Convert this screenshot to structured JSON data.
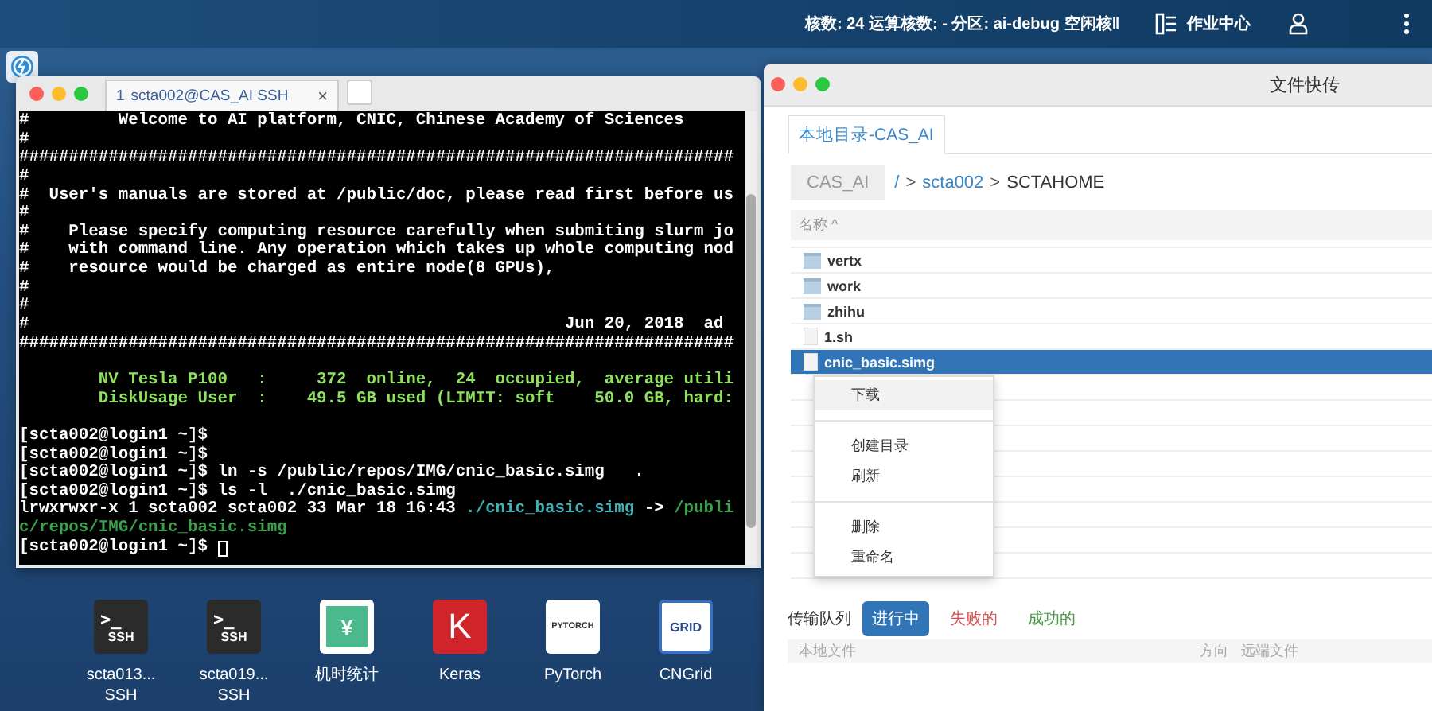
{
  "top_bar": {
    "status": "核数: 24 运算核数: - 分区: ai-debug 空闲核‖",
    "jobs_link": "作业中心"
  },
  "terminal": {
    "tab": {
      "number": "1",
      "title": "scta002@CAS_AI SSH",
      "close": "×"
    },
    "lines": [
      {
        "kind": "plain",
        "segments": [
          {
            "kind": "white",
            "text": "#         Welcome to AI platform, CNIC, Chinese Academy of Sciences"
          }
        ]
      },
      {
        "kind": "plain",
        "segments": [
          {
            "kind": "white",
            "text": "#"
          }
        ]
      },
      {
        "kind": "plain",
        "segments": [
          {
            "kind": "white",
            "text": "########################################################################"
          }
        ]
      },
      {
        "kind": "plain",
        "segments": [
          {
            "kind": "white",
            "text": "#"
          }
        ]
      },
      {
        "kind": "plain",
        "segments": [
          {
            "kind": "white",
            "text": "#  User's manuals are stored at /public/doc, please read first before us"
          }
        ]
      },
      {
        "kind": "plain",
        "segments": [
          {
            "kind": "white",
            "text": "#"
          }
        ]
      },
      {
        "kind": "plain",
        "segments": [
          {
            "kind": "white",
            "text": "#    Please specify computing resource carefully when submiting slurm jo"
          }
        ]
      },
      {
        "kind": "plain",
        "segments": [
          {
            "kind": "white",
            "text": "#    with command line. Any operation which takes up whole computing nod"
          }
        ]
      },
      {
        "kind": "plain",
        "segments": [
          {
            "kind": "white",
            "text": "#    resource would be charged as entire node(8 GPUs),"
          }
        ]
      },
      {
        "kind": "plain",
        "segments": [
          {
            "kind": "white",
            "text": "#"
          }
        ]
      },
      {
        "kind": "plain",
        "segments": [
          {
            "kind": "white",
            "text": "#"
          }
        ]
      },
      {
        "kind": "plain",
        "segments": [
          {
            "kind": "white",
            "text": "#                                                      Jun 20, 2018  ad"
          }
        ]
      },
      {
        "kind": "plain",
        "segments": [
          {
            "kind": "white",
            "text": "########################################################################"
          }
        ]
      },
      {
        "kind": "blank"
      },
      {
        "kind": "plain",
        "segments": [
          {
            "kind": "green",
            "text": "        NV Tesla P100   :     372  online,  24  occupied,  average utili"
          }
        ]
      },
      {
        "kind": "plain",
        "segments": [
          {
            "kind": "green",
            "text": "        DiskUsage User  :    49.5 GB used (LIMIT: soft    50.0 GB, hard:"
          }
        ]
      },
      {
        "kind": "blank"
      },
      {
        "kind": "plain",
        "segments": [
          {
            "kind": "white",
            "text": "[scta002@login1 ~]$"
          }
        ]
      },
      {
        "kind": "plain",
        "segments": [
          {
            "kind": "white",
            "text": "[scta002@login1 ~]$"
          }
        ]
      },
      {
        "kind": "plain",
        "segments": [
          {
            "kind": "white",
            "text": "[scta002@login1 ~]$ ln -s /public/repos/IMG/cnic_basic.simg   ."
          }
        ]
      },
      {
        "kind": "plain",
        "segments": [
          {
            "kind": "white",
            "text": "[scta002@login1 ~]$ ls -l  ./cnic_basic.simg"
          }
        ]
      },
      {
        "kind": "plain",
        "segments": [
          {
            "kind": "white",
            "text": "lrwxrwxr-x 1 scta002 scta002 33 Mar 18 16:43 "
          },
          {
            "kind": "link",
            "text": "./cnic_basic.simg"
          },
          {
            "kind": "white",
            "text": " -> "
          },
          {
            "kind": "target",
            "text": "/publi"
          }
        ]
      },
      {
        "kind": "plain",
        "segments": [
          {
            "kind": "target",
            "text": "c/repos/IMG/cnic_basic.simg"
          }
        ]
      },
      {
        "kind": "prompt",
        "segments": [
          {
            "kind": "white",
            "text": "[scta002@login1 ~]$ "
          }
        ]
      }
    ]
  },
  "desktop_icons": [
    {
      "kind": "ssh",
      "glyph": ">_",
      "badge": "SSH",
      "label": "scta013...",
      "sublabel": "SSH"
    },
    {
      "kind": "ssh",
      "glyph": ">_",
      "badge": "SSH",
      "label": "scta019...",
      "sublabel": "SSH"
    },
    {
      "kind": "yen",
      "glyph": "¥",
      "label": "机时统计"
    },
    {
      "kind": "keras",
      "glyph": "K",
      "label": "Keras"
    },
    {
      "kind": "pytorch",
      "glyph": "PYTORCH",
      "label": "PyTorch"
    },
    {
      "kind": "cngrid",
      "glyph": "GRID",
      "label": "CNGrid"
    }
  ],
  "file_window": {
    "title": "文件快传",
    "tab": "本地目录-CAS_AI",
    "breadcrumb": {
      "root": "CAS_AI",
      "parts": [
        {
          "kind": "link",
          "text": "/"
        },
        {
          "kind": "sep",
          "text": ">"
        },
        {
          "kind": "link",
          "text": "scta002"
        },
        {
          "kind": "sep",
          "text": ">"
        },
        {
          "kind": "current",
          "text": "SCTAHOME"
        }
      ]
    },
    "column": "名称 ^",
    "files": [
      {
        "name": "vertx",
        "kind": "folder",
        "selected": false
      },
      {
        "name": "work",
        "kind": "folder",
        "selected": false
      },
      {
        "name": "zhihu",
        "kind": "folder",
        "selected": false
      },
      {
        "name": "1.sh",
        "kind": "file",
        "selected": false
      },
      {
        "name": "cnic_basic.simg",
        "kind": "file",
        "selected": true
      }
    ],
    "context_menu": [
      [
        {
          "label": "下载",
          "hovered": true
        }
      ],
      [
        {
          "label": "创建目录",
          "hovered": false
        },
        {
          "label": "刷新",
          "hovered": false
        }
      ],
      [
        {
          "label": "删除",
          "hovered": false
        },
        {
          "label": "重命名",
          "hovered": false
        }
      ]
    ],
    "queue": {
      "label": "传输队列",
      "filters": [
        {
          "label": "进行中",
          "kind": "running",
          "selected": true
        },
        {
          "label": "失败的",
          "kind": "failed",
          "selected": false
        },
        {
          "label": "成功的",
          "kind": "success",
          "selected": false
        }
      ],
      "columns": [
        "本地文件",
        "方向",
        "远端文件"
      ]
    }
  }
}
